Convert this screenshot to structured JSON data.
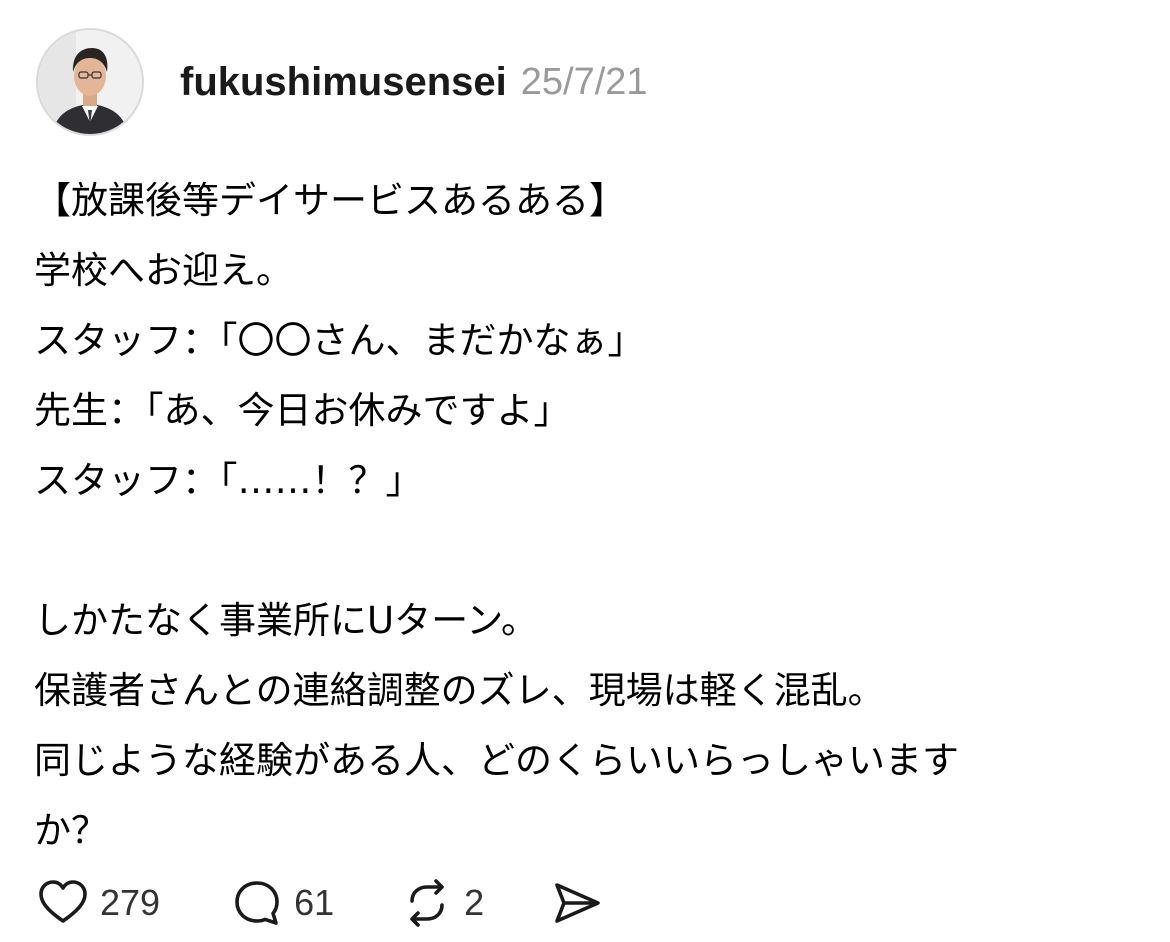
{
  "post": {
    "username": "fukushimusensei",
    "timestamp": "25/7/21",
    "body_lines": [
      "【放課後等デイサービスあるある】",
      "学校へお迎え。",
      "スタッフ：「〇〇さん、まだかなぁ」",
      "先生：「あ、今日お休みですよ」",
      "スタッフ：「……！？」",
      "",
      "しかたなく事業所にUターン。",
      "保護者さんとの連絡調整のズレ、現場は軽く混乱。",
      "同じような経験がある人、どのくらいいらっしゃいます",
      "か？"
    ]
  },
  "actions": {
    "like": {
      "icon": "heart-icon",
      "count": "279"
    },
    "reply": {
      "icon": "comment-bubble-icon",
      "count": "61"
    },
    "repost": {
      "icon": "repost-arrows-icon",
      "count": "2"
    },
    "share": {
      "icon": "send-icon"
    }
  }
}
